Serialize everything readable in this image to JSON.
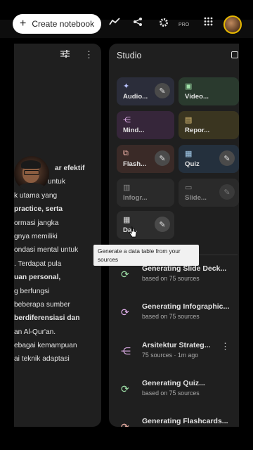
{
  "topbar": {
    "create_label": "Create notebook",
    "pro_badge": "PRO",
    "icons": [
      "plus-icon",
      "analytics-icon",
      "share-icon",
      "settings-icon",
      "apps-grid-icon"
    ]
  },
  "notes": {
    "lines": [
      "ar efektif",
      "untuk",
      "k utama yang",
      "practice, serta",
      "ormasi jangka",
      "gnya memiliki",
      "ondasi mental untuk",
      ". Terdapat pula",
      "uan personal,",
      "g berfungsi",
      " beberapa sumber",
      "berdiferensiasi dan",
      "an Al-Qur'an.",
      "ebagai kemampuan",
      "ai teknik adaptasi"
    ]
  },
  "studio": {
    "title": "Studio",
    "tiles": [
      {
        "label": "Audio..."
      },
      {
        "label": "Video..."
      },
      {
        "label": "Mind..."
      },
      {
        "label": "Repor..."
      },
      {
        "label": "Flash..."
      },
      {
        "label": "Quiz"
      },
      {
        "label": "Infogr..."
      },
      {
        "label": "Slide..."
      },
      {
        "label": "Da..."
      }
    ],
    "tooltip": "Generate a data table from your sources",
    "items": [
      {
        "title": "Generating Slide Deck...",
        "sub": "based on 75 sources"
      },
      {
        "title": "Generating Infographic...",
        "sub": "based on 75 sources"
      },
      {
        "title": "Arsitektur Strateg...",
        "sub": "75 sources · 1m ago"
      },
      {
        "title": "Generating Quiz...",
        "sub": "based on 75 sources"
      },
      {
        "title": "Generating Flashcards...",
        "sub": ""
      }
    ]
  },
  "colors": {
    "audio_bg": "#2b2d3a",
    "video_bg": "#2a3a2e",
    "mind_bg": "#36263a",
    "report_bg": "#3a3520",
    "flash_bg": "#3a2a27",
    "quiz_bg": "#24303d",
    "dim_bg": "#2a2a2a",
    "data_bg": "#2d2d2d"
  }
}
